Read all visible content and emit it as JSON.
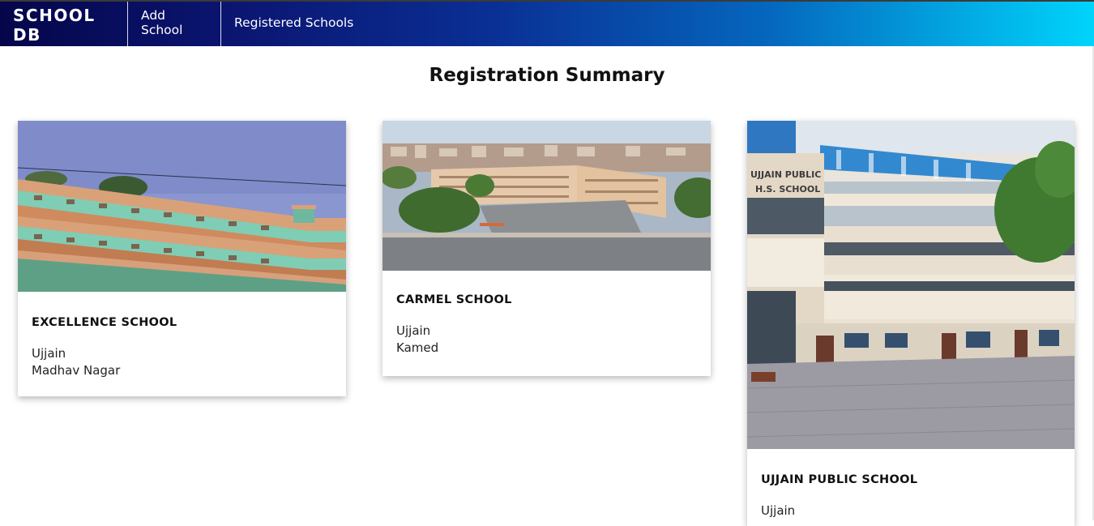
{
  "nav": {
    "brand": "SCHOOL DB",
    "links": [
      "Add School",
      "Registered Schools"
    ]
  },
  "main": {
    "title": "Registration Summary"
  },
  "schools": [
    {
      "name": "EXCELLENCE SCHOOL",
      "city": "Ujjain",
      "area": "Madhav Nagar"
    },
    {
      "name": "CARMEL SCHOOL",
      "city": "Ujjain",
      "area": "Kamed"
    },
    {
      "name": "UJJAIN PUBLIC SCHOOL",
      "city": "Ujjain",
      "area": ""
    }
  ],
  "colors": {
    "nav_gradient_start": "#05064a",
    "nav_gradient_end": "#00d4fb"
  }
}
